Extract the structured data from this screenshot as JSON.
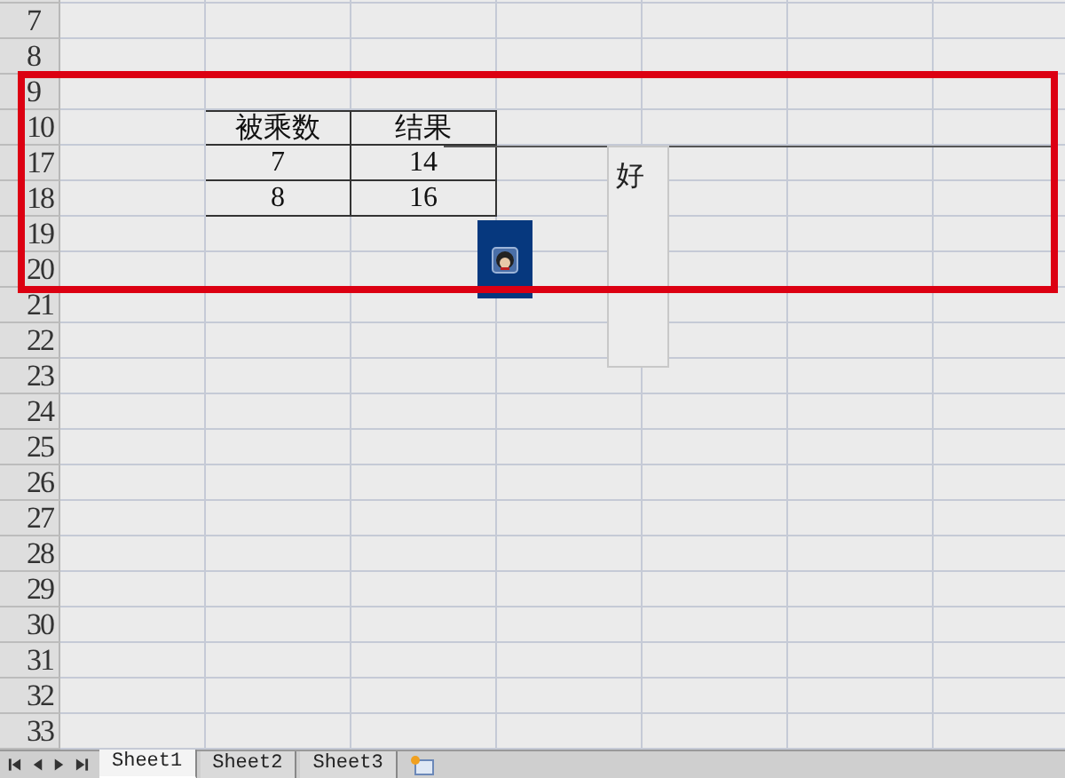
{
  "rows": [
    {
      "label": "7"
    },
    {
      "label": "8"
    },
    {
      "label": "9"
    },
    {
      "label": "10",
      "values": [
        "被乘数",
        "结果"
      ]
    },
    {
      "label": "17",
      "values": [
        "7",
        "14"
      ]
    },
    {
      "label": "18",
      "values": [
        "8",
        "16"
      ]
    },
    {
      "label": "19"
    },
    {
      "label": "20"
    },
    {
      "label": "21"
    },
    {
      "label": "22"
    },
    {
      "label": "23"
    },
    {
      "label": "24"
    },
    {
      "label": "25"
    },
    {
      "label": "26"
    },
    {
      "label": "27"
    },
    {
      "label": "28"
    },
    {
      "label": "29"
    },
    {
      "label": "30"
    },
    {
      "label": "31"
    },
    {
      "label": "32"
    },
    {
      "label": "33"
    }
  ],
  "comment": {
    "text": "好"
  },
  "sheet_tabs": [
    {
      "label": "Sheet1",
      "selected": true
    },
    {
      "label": "Sheet2",
      "selected": false
    },
    {
      "label": "Sheet3",
      "selected": false
    }
  ]
}
